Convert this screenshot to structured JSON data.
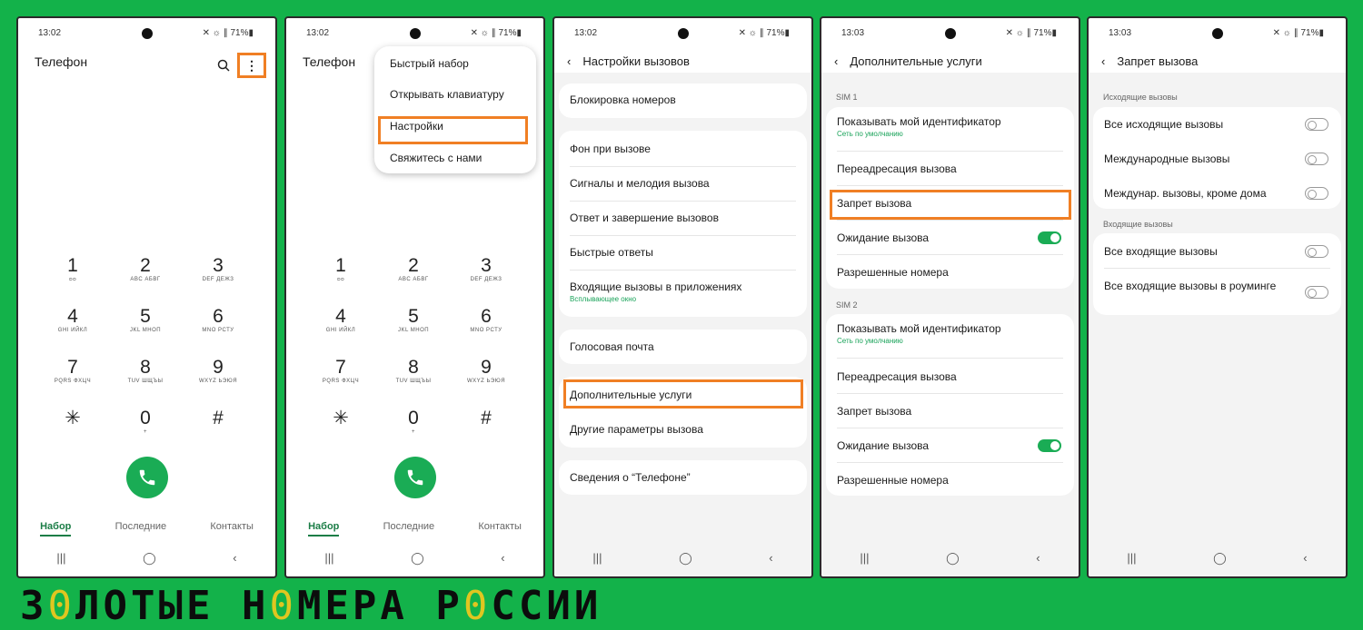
{
  "status": {
    "time1": "13:02",
    "time2": "13:03",
    "icons": "✕ ☼ ∥ 71%▮"
  },
  "phone1": {
    "title": "Телефон",
    "search_icon": "search-icon",
    "more_icon": "more-vert-icon",
    "keys": [
      {
        "d": "1",
        "l": "ᴑᴑ"
      },
      {
        "d": "2",
        "l": "ABC АБВГ"
      },
      {
        "d": "3",
        "l": "DEF ДЕЖЗ"
      },
      {
        "d": "4",
        "l": "GHI ИЙКЛ"
      },
      {
        "d": "5",
        "l": "JKL МНОП"
      },
      {
        "d": "6",
        "l": "MNO РСТУ"
      },
      {
        "d": "7",
        "l": "PQRS ФХЦЧ"
      },
      {
        "d": "8",
        "l": "TUV ШЩЪЫ"
      },
      {
        "d": "9",
        "l": "WXYZ ЬЭЮЯ"
      },
      {
        "d": "✳",
        "l": ""
      },
      {
        "d": "0",
        "l": "+"
      },
      {
        "d": "#",
        "l": ""
      }
    ],
    "tabs": [
      "Набор",
      "Последние",
      "Контакты"
    ]
  },
  "menu": {
    "items": [
      "Быстрый набор",
      "Открывать клавиатуру",
      "Настройки",
      "Свяжитесь с нами"
    ]
  },
  "call_settings": {
    "title": "Настройки вызовов",
    "blocking": "Блокировка номеров",
    "items": [
      "Фон при вызове",
      "Сигналы и мелодия вызова",
      "Ответ и завершение вызовов",
      "Быстрые ответы",
      "Входящие вызовы в приложениях"
    ],
    "apps_sub": "Всплывающее окно",
    "voicemail": "Голосовая почта",
    "more": [
      "Дополнительные услуги",
      "Другие параметры вызова"
    ],
    "about": "Сведения о “Телефоне”"
  },
  "supplementary": {
    "title": "Дополнительные услуги",
    "sim1": "SIM 1",
    "sim2": "SIM 2",
    "caller_id": "Показывать мой идентификатор",
    "caller_id_sub": "Сеть по умолчанию",
    "forwarding": "Переадресация вызова",
    "barring": "Запрет вызова",
    "waiting": "Ожидание вызова",
    "fdn": "Разрешенные номера"
  },
  "barring": {
    "title": "Запрет вызова",
    "outgoing_header": "Исходящие вызовы",
    "outgoing": [
      "Все исходящие вызовы",
      "Международные вызовы",
      "Междунар. вызовы, кроме дома"
    ],
    "incoming_header": "Входящие вызовы",
    "incoming": [
      "Все входящие вызовы",
      "Все входящие вызовы в роуминге"
    ]
  },
  "footer": {
    "brand_pre": "З",
    "brand_o1": "0",
    "brand_mid": "ЛОТЫЕ Н",
    "brand_o2": "0",
    "brand_mid2": "МЕРА Р",
    "brand_o3": "0",
    "brand_end": "ССИИ"
  },
  "nav_icons": [
    "recents-nav-icon",
    "home-nav-icon",
    "back-nav-icon"
  ],
  "colors": {
    "accent": "#1aac55",
    "highlight": "#f07f24",
    "background": "#13b24a"
  }
}
